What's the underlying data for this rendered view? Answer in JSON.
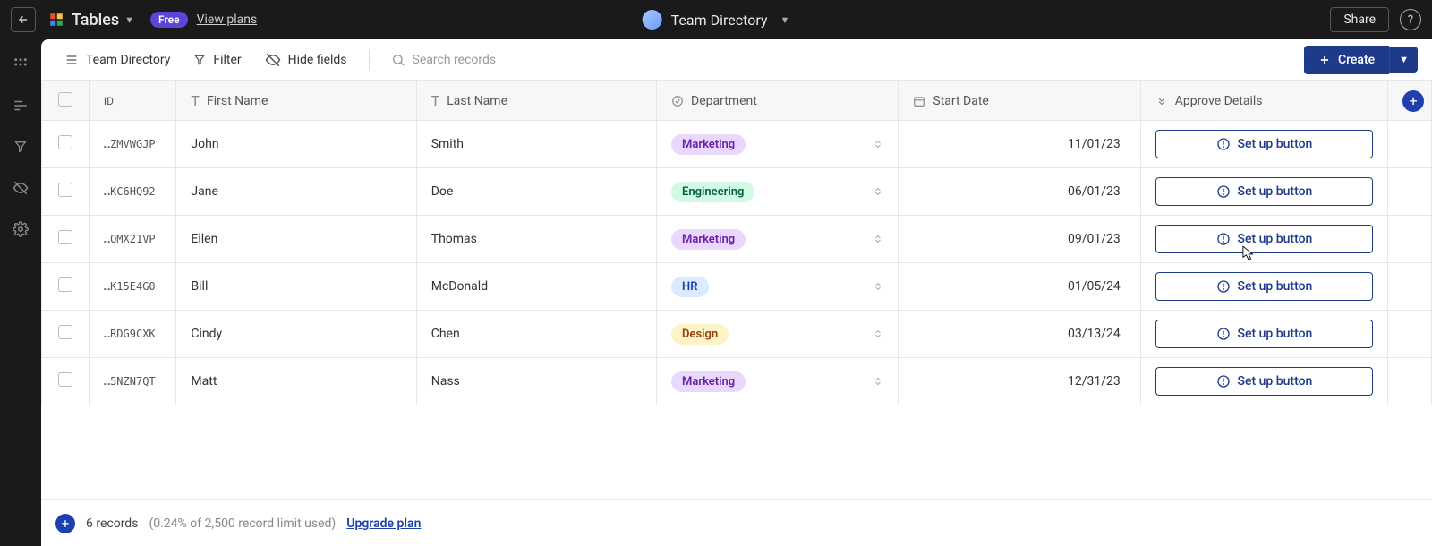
{
  "topbar": {
    "app_name": "Tables",
    "free_badge": "Free",
    "view_plans": "View plans",
    "doc_title": "Team Directory",
    "share": "Share"
  },
  "toolbar": {
    "view_name": "Team Directory",
    "filter": "Filter",
    "hide_fields": "Hide fields",
    "search_placeholder": "Search records",
    "create": "Create"
  },
  "columns": {
    "id": "ID",
    "first": "First Name",
    "last": "Last Name",
    "dept": "Department",
    "start": "Start Date",
    "approve": "Approve Details"
  },
  "dept_labels": {
    "marketing": "Marketing",
    "engineering": "Engineering",
    "hr": "HR",
    "design": "Design"
  },
  "rows": [
    {
      "id": "…ZMVWGJP",
      "first": "John",
      "last": "Smith",
      "dept": "marketing",
      "date": "11/01/23"
    },
    {
      "id": "…KC6HQ92",
      "first": "Jane",
      "last": "Doe",
      "dept": "engineering",
      "date": "06/01/23"
    },
    {
      "id": "…QMX21VP",
      "first": "Ellen",
      "last": "Thomas",
      "dept": "marketing",
      "date": "09/01/23"
    },
    {
      "id": "…K15E4G0",
      "first": "Bill",
      "last": "McDonald",
      "dept": "hr",
      "date": "01/05/24"
    },
    {
      "id": "…RDG9CXK",
      "first": "Cindy",
      "last": "Chen",
      "dept": "design",
      "date": "03/13/24"
    },
    {
      "id": "…5NZN7QT",
      "first": "Matt",
      "last": "Nass",
      "dept": "marketing",
      "date": "12/31/23"
    }
  ],
  "setup_label": "Set up button",
  "footer": {
    "count": "6 records",
    "limit": "(0.24% of 2,500 record limit used)",
    "upgrade": "Upgrade plan"
  }
}
